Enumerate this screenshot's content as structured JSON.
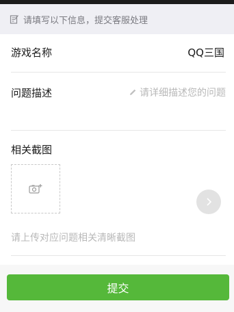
{
  "notice": {
    "icon": "edit-note-icon",
    "text": "请填写以下信息，提交客服处理"
  },
  "form": {
    "game_name": {
      "label": "游戏名称",
      "value": "QQ三国"
    },
    "problem": {
      "label": "问题描述",
      "placeholder": "请详细描述您的问题",
      "icon": "pencil-icon"
    },
    "screenshot": {
      "label": "相关截图",
      "upload_icon": "add-photo-icon",
      "hint": "请上传对应问题相关清晰截图"
    }
  },
  "float_button": {
    "icon": "chevron-right-icon"
  },
  "submit": {
    "label": "提交",
    "color": "#55b83a"
  }
}
